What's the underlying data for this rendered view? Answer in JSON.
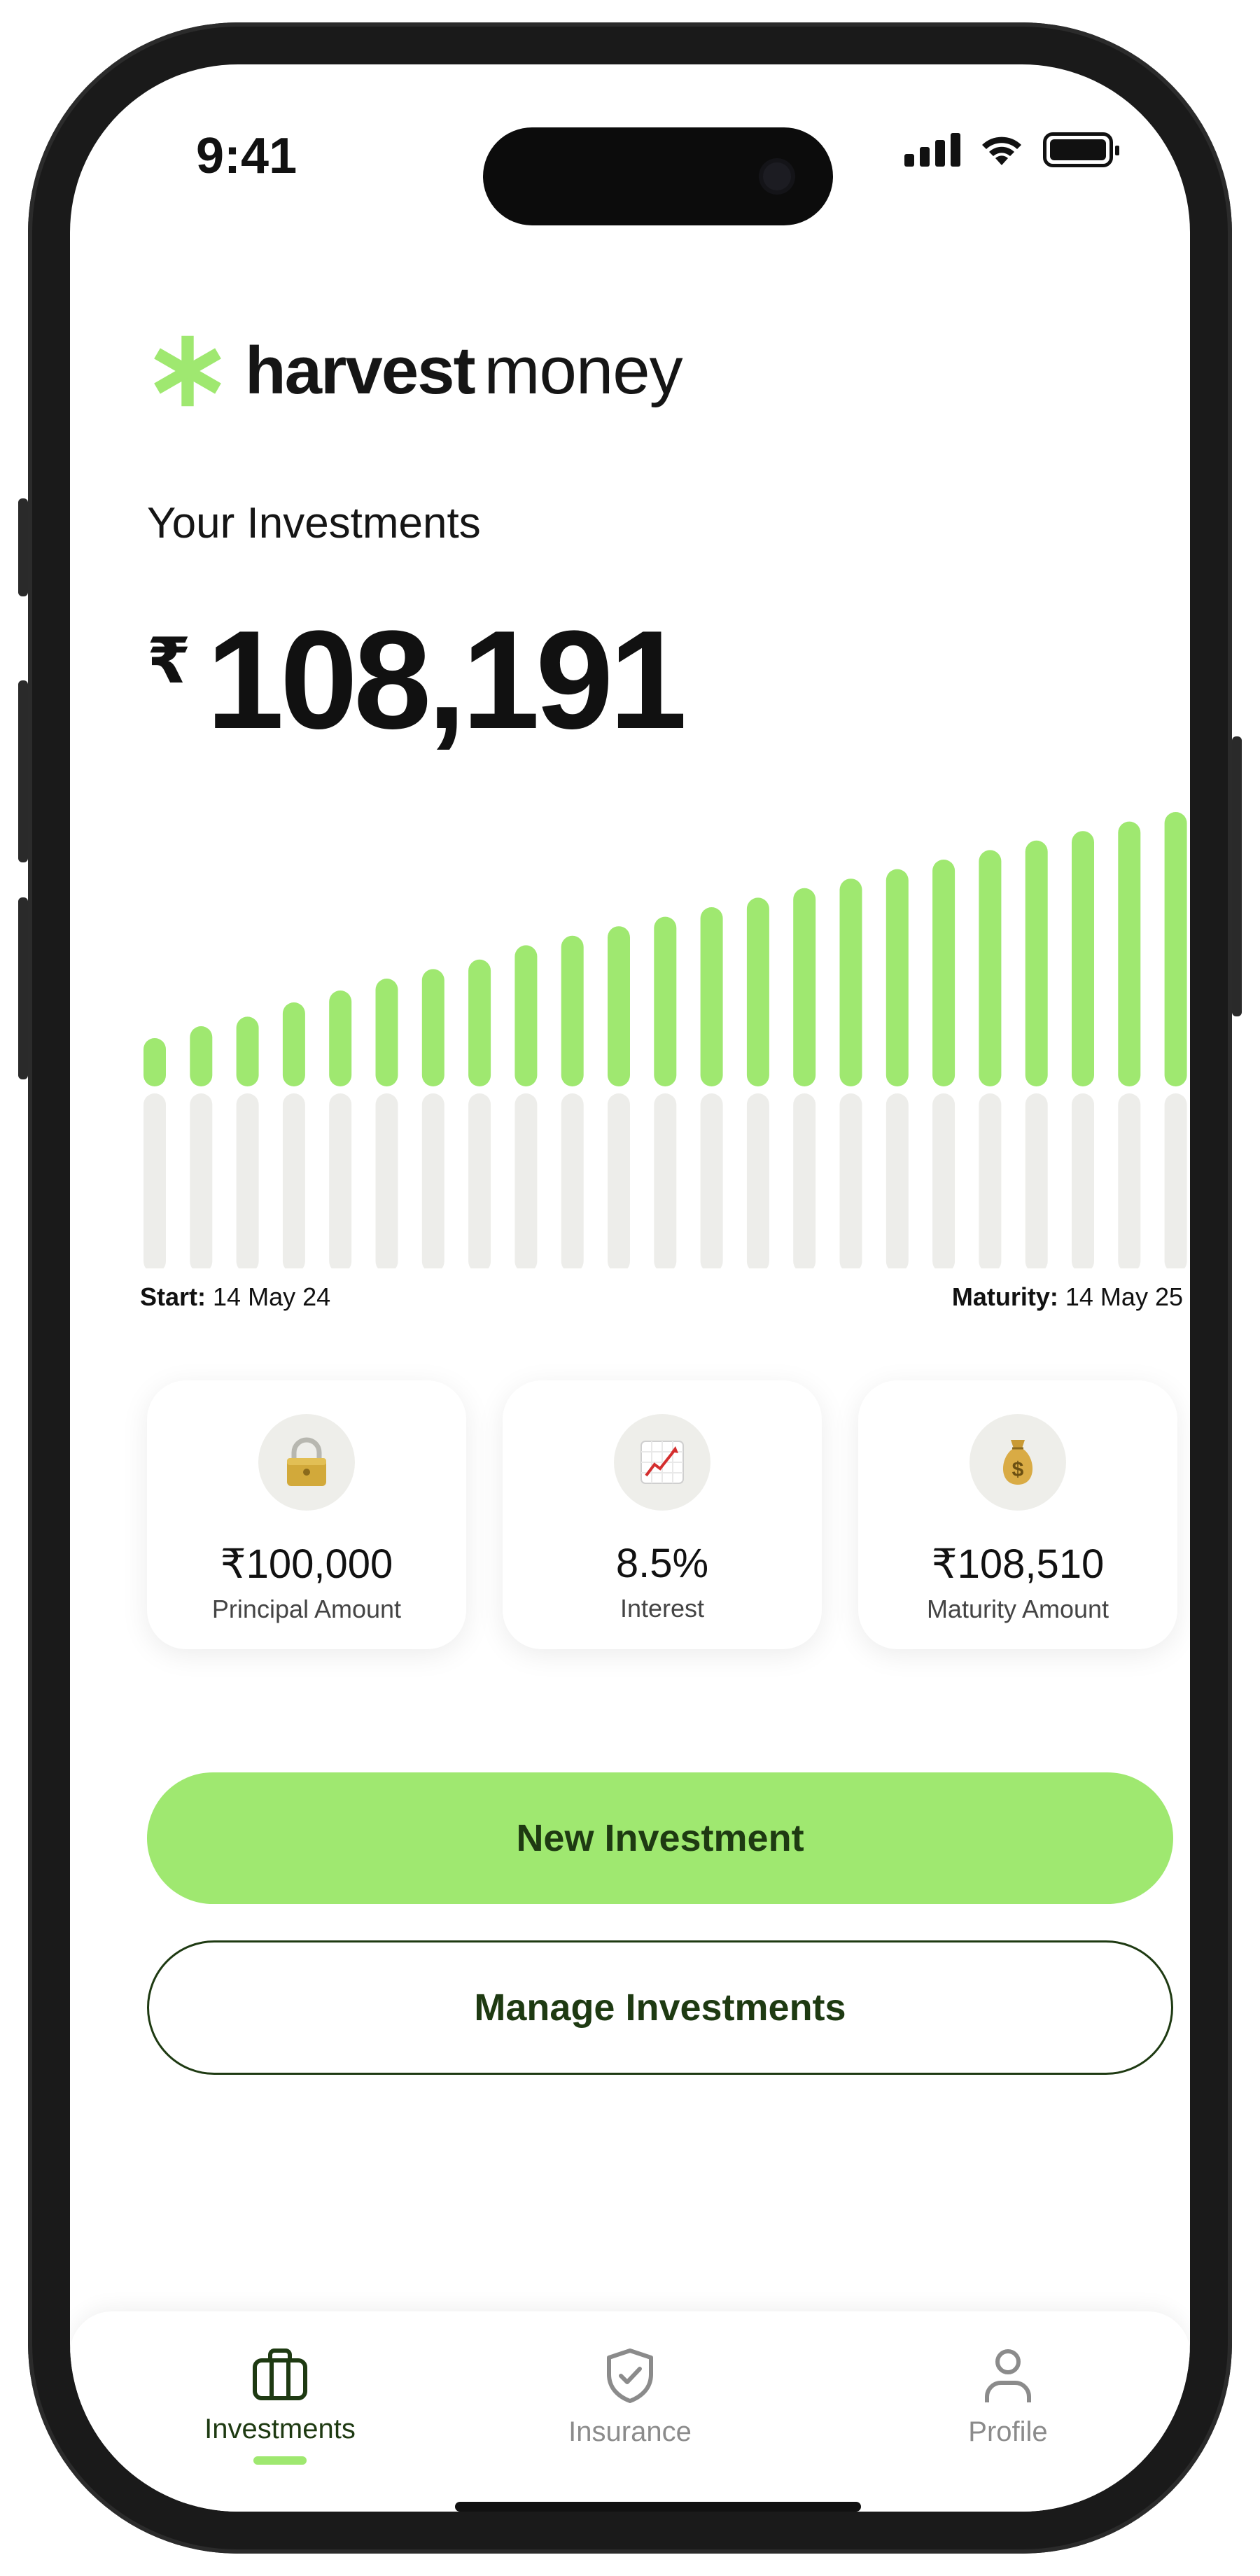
{
  "status_bar": {
    "time": "9:41"
  },
  "brand": {
    "name_bold": "harvest",
    "name_light": "money",
    "accent": "#9fe870"
  },
  "investments": {
    "title": "Your Investments",
    "currency_symbol": "₹",
    "balance": "108,191"
  },
  "chart_data": {
    "type": "bar",
    "values": [
      5,
      10,
      14,
      20,
      25,
      30,
      34,
      38,
      44,
      48,
      52,
      56,
      60,
      64,
      68,
      72,
      76,
      80,
      84,
      88,
      92,
      96,
      100
    ],
    "max": 100,
    "colors": {
      "filled": "#9fe870",
      "track": "#ededea"
    }
  },
  "dates": {
    "start_label": "Start:",
    "start_value": "14 May 24",
    "maturity_label": "Maturity:",
    "maturity_value": "14 May 25"
  },
  "stats": [
    {
      "icon": "lock-icon",
      "value": "₹100,000",
      "label": "Principal Amount"
    },
    {
      "icon": "chart-increasing-icon",
      "value": "8.5%",
      "label": "Interest"
    },
    {
      "icon": "money-bag-icon",
      "value": "₹108,510",
      "label": "Maturity Amount"
    }
  ],
  "actions": {
    "new_investment": "New Investment",
    "manage_investments": "Manage Investments"
  },
  "tabbar": {
    "active": "investments",
    "items": [
      {
        "key": "investments",
        "label": "Investments",
        "icon": "briefcase-icon"
      },
      {
        "key": "insurance",
        "label": "Insurance",
        "icon": "shield-check-icon"
      },
      {
        "key": "profile",
        "label": "Profile",
        "icon": "person-icon"
      }
    ]
  }
}
